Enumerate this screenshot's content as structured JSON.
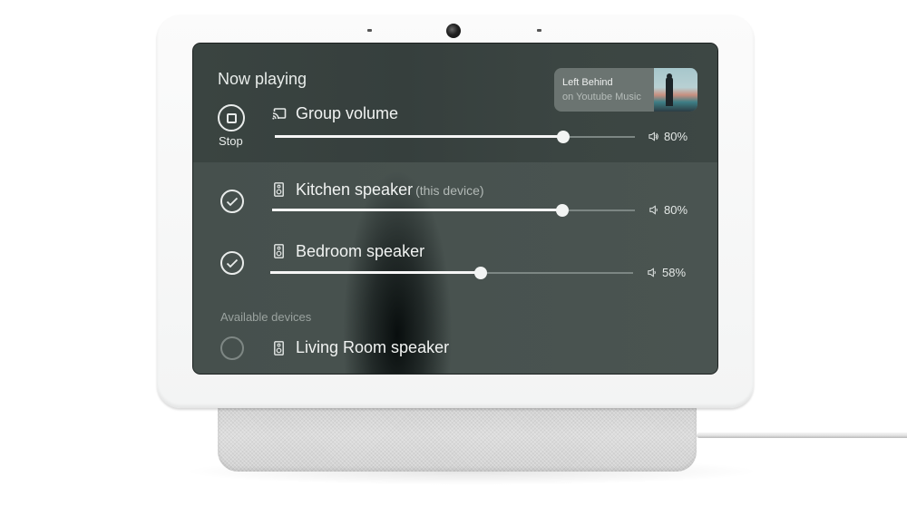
{
  "screen": {
    "title": "Now playing",
    "stop": {
      "label": "Stop",
      "icon": "stop-icon"
    },
    "now_playing_card": {
      "track": "Left Behind",
      "source": "on Youtube Music",
      "art_icon": "album-art"
    },
    "group": {
      "icon": "cast-icon",
      "name": "Group volume",
      "volume_percent": 80,
      "volume_label": "80%"
    },
    "devices": [
      {
        "icon": "speaker-icon",
        "name": "Kitchen speaker",
        "suffix": "(this device)",
        "selected": true,
        "volume_percent": 80,
        "volume_label": "80%"
      },
      {
        "icon": "speaker-icon",
        "name": "Bedroom speaker",
        "suffix": "",
        "selected": true,
        "volume_percent": 58,
        "volume_label": "58%"
      }
    ],
    "available_label": "Available devices",
    "available": [
      {
        "icon": "speaker-icon",
        "name": "Living Room speaker",
        "selected": false
      }
    ],
    "colors": {
      "accent": "#f5f5f5",
      "background": "#4a5451"
    }
  }
}
